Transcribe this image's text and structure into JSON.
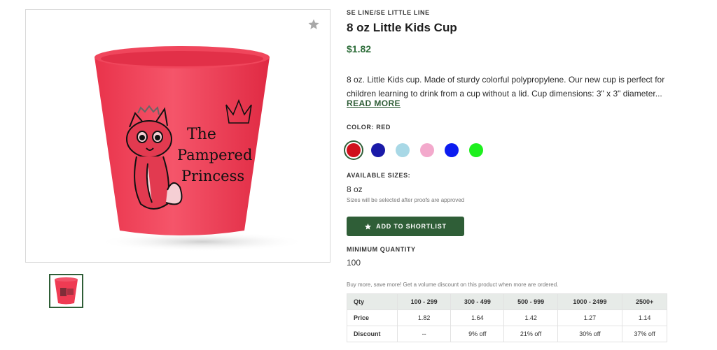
{
  "product": {
    "brand": "SE LINE/SE LITTLE LINE",
    "title": "8 oz Little Kids Cup",
    "price": "$1.82",
    "description": "8 oz. Little Kids cup. Made of sturdy colorful polypropylene. Our new cup is perfect for children learning to drink from a cup without a lid. Cup dimensions: 3\" x 3\" diameter...",
    "read_more": "READ MORE"
  },
  "image": {
    "print_line1": "The",
    "print_line2": "Pampered",
    "print_line3": "Princess"
  },
  "color": {
    "label": "COLOR: RED",
    "swatches": [
      {
        "name": "red",
        "hex": "#d0101c",
        "selected": true
      },
      {
        "name": "navy",
        "hex": "#1a1aa8"
      },
      {
        "name": "light-blue",
        "hex": "#a8d8e6"
      },
      {
        "name": "pink",
        "hex": "#f3a9cc"
      },
      {
        "name": "blue",
        "hex": "#0c1cf0"
      },
      {
        "name": "green",
        "hex": "#1ef01e"
      }
    ]
  },
  "sizes": {
    "label": "AVAILABLE SIZES:",
    "value": "8 oz",
    "note": "Sizes will be selected after proofs are approved"
  },
  "shortlist": {
    "label": "ADD TO SHORTLIST"
  },
  "min_qty": {
    "label": "MINIMUM QUANTITY",
    "value": "100"
  },
  "volume": {
    "note": "Buy more, save more! Get a volume discount on this product when more are ordered.",
    "headers": [
      "Qty",
      "100 - 299",
      "300 - 499",
      "500 - 999",
      "1000 - 2499",
      "2500+"
    ],
    "price_row": [
      "Price",
      "1.82",
      "1.64",
      "1.42",
      "1.27",
      "1.14"
    ],
    "discount_row": [
      "Discount",
      "--",
      "9% off",
      "21% off",
      "30% off",
      "37% off"
    ]
  },
  "colors": {
    "accent": "#2f5e37",
    "price": "#2f6e3b",
    "cup": "#ef3b53"
  }
}
